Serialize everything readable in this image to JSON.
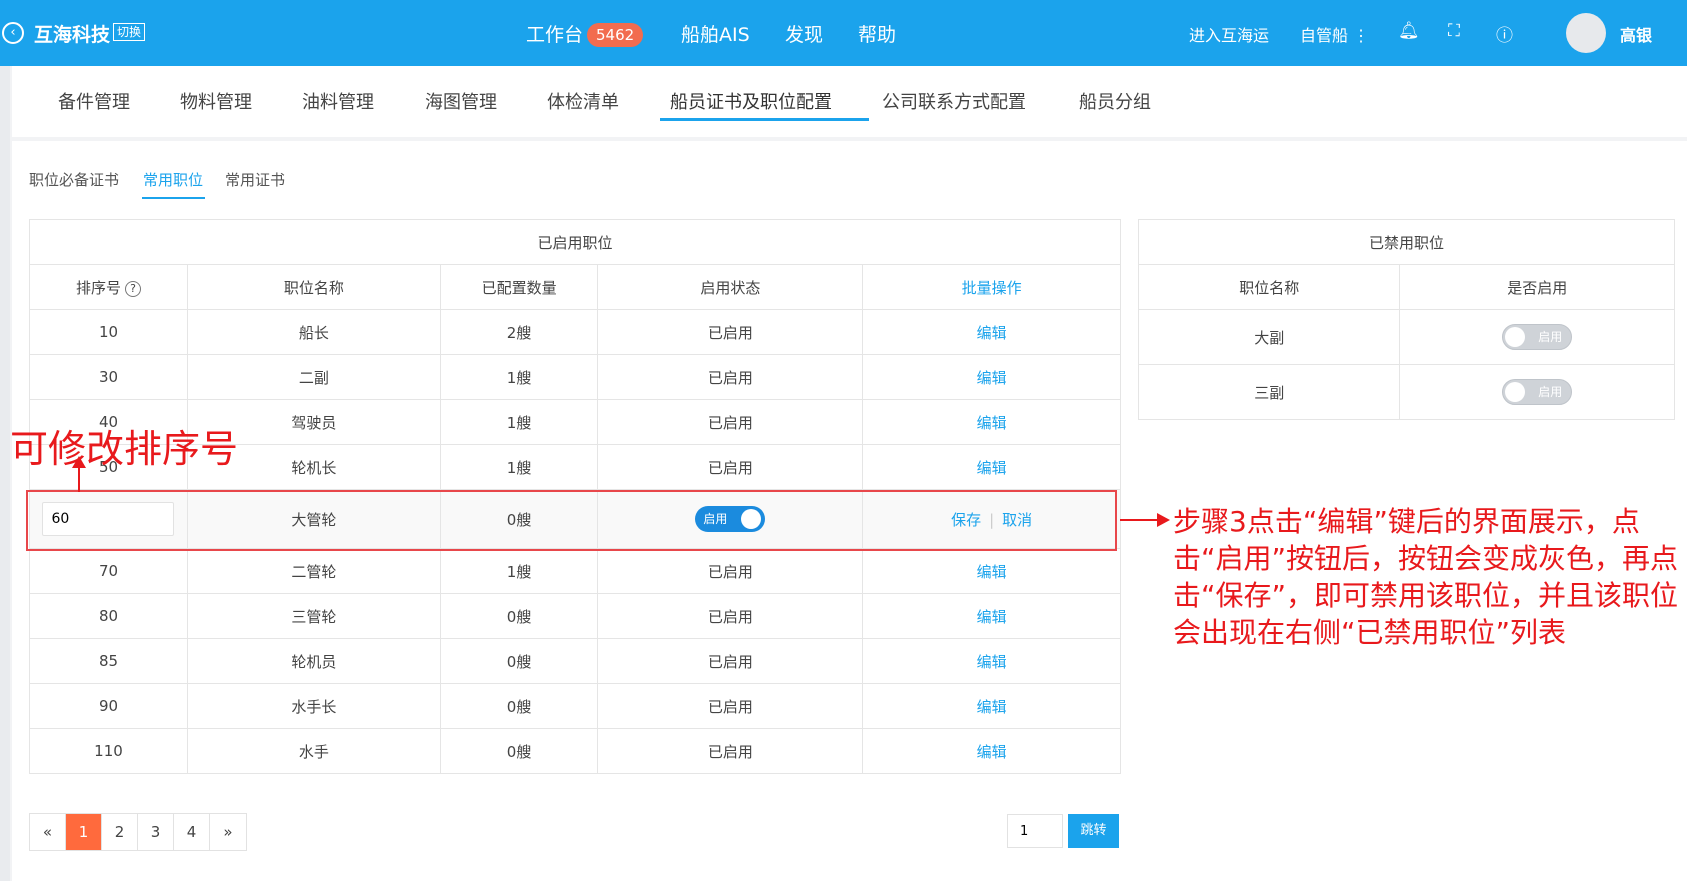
{
  "header": {
    "brand": "互海科技",
    "switch_label": "切换",
    "nav": [
      {
        "label": "工作台",
        "badge": "5462"
      },
      {
        "label": "船舶AIS"
      },
      {
        "label": "发现"
      },
      {
        "label": "帮助"
      }
    ],
    "enter_hhy": "进入互海运",
    "self_ship": "自管船",
    "user_name": "高银"
  },
  "tabs": [
    "备件管理",
    "物料管理",
    "油料管理",
    "海图管理",
    "体检清单",
    "船员证书及职位配置",
    "公司联系方式配置",
    "船员分组"
  ],
  "active_tab": "船员证书及职位配置",
  "subtabs": [
    "职位必备证书",
    "常用职位",
    "常用证书"
  ],
  "active_subtab": "常用职位",
  "enabled_table": {
    "title": "已启用职位",
    "headers": [
      "排序号",
      "职位名称",
      "已配置数量",
      "启用状态",
      "批量操作"
    ],
    "rows": [
      {
        "sort": "10",
        "name": "船长",
        "count": "2艘",
        "status": "已启用",
        "action": "编辑"
      },
      {
        "sort": "30",
        "name": "二副",
        "count": "1艘",
        "status": "已启用",
        "action": "编辑"
      },
      {
        "sort": "40",
        "name": "驾驶员",
        "count": "1艘",
        "status": "已启用",
        "action": "编辑"
      },
      {
        "sort": "50",
        "name": "轮机长",
        "count": "1艘",
        "status": "已启用",
        "action": "编辑"
      }
    ],
    "edit_row": {
      "sort_value": "60",
      "name": "大管轮",
      "count": "0艘",
      "toggle_label": "启用",
      "save": "保存",
      "cancel": "取消"
    },
    "rows_after": [
      {
        "sort": "70",
        "name": "二管轮",
        "count": "1艘",
        "status": "已启用",
        "action": "编辑"
      },
      {
        "sort": "80",
        "name": "三管轮",
        "count": "0艘",
        "status": "已启用",
        "action": "编辑"
      },
      {
        "sort": "85",
        "name": "轮机员",
        "count": "0艘",
        "status": "已启用",
        "action": "编辑"
      },
      {
        "sort": "90",
        "name": "水手长",
        "count": "0艘",
        "status": "已启用",
        "action": "编辑"
      },
      {
        "sort": "110",
        "name": "水手",
        "count": "0艘",
        "status": "已启用",
        "action": "编辑"
      }
    ]
  },
  "disabled_table": {
    "title": "已禁用职位",
    "headers": [
      "职位名称",
      "是否启用"
    ],
    "rows": [
      {
        "name": "大副",
        "toggle_label": "启用"
      },
      {
        "name": "三副",
        "toggle_label": "启用"
      }
    ]
  },
  "annotations": {
    "left": "可修改排序号",
    "right": "步骤3点击“编辑”键后的界面展示，点击“启用”按钮后，按钮会变成灰色，再点击“保存”，即可禁用该职位，并且该职位会出现在右侧“已禁用职位”列表"
  },
  "pagination": {
    "prev": "«",
    "next": "»",
    "pages": [
      "1",
      "2",
      "3",
      "4"
    ],
    "current": "1",
    "jump_value": "1",
    "jump_label": "跳转"
  },
  "colors": {
    "primary": "#1ba3ec",
    "annotation": "#e8191c",
    "pager_active": "#ff6a3d",
    "badge": "#f26c4f"
  }
}
